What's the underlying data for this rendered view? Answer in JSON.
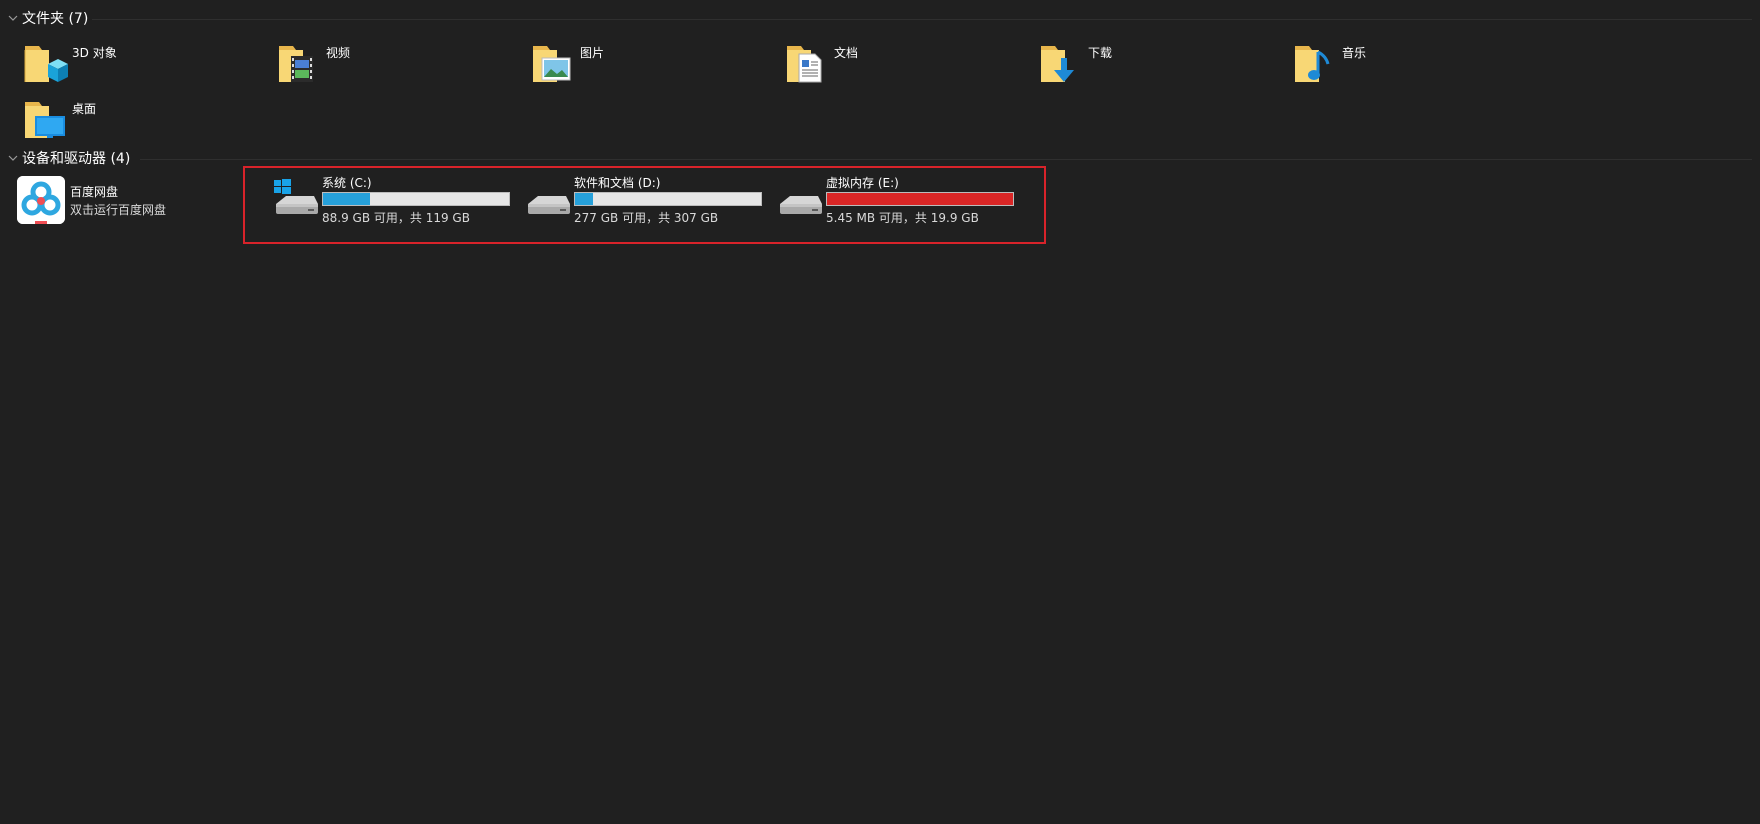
{
  "groups": {
    "folders": {
      "title": "文件夹 (7)"
    },
    "devices": {
      "title": "设备和驱动器 (4)"
    }
  },
  "folders": [
    {
      "label": "3D 对象",
      "icon": "3d-objects-folder-icon"
    },
    {
      "label": "视频",
      "icon": "videos-folder-icon"
    },
    {
      "label": "图片",
      "icon": "pictures-folder-icon"
    },
    {
      "label": "文档",
      "icon": "documents-folder-icon"
    },
    {
      "label": "下载",
      "icon": "downloads-folder-icon"
    },
    {
      "label": "音乐",
      "icon": "music-folder-icon"
    },
    {
      "label": "桌面",
      "icon": "desktop-folder-icon"
    }
  ],
  "app": {
    "name": "百度网盘",
    "subtitle": "双击运行百度网盘",
    "icon": "baidu-netdisk-icon"
  },
  "drives": [
    {
      "name": "系统 (C:)",
      "space": "88.9 GB 可用，共 119 GB",
      "used_fraction": 0.253,
      "icon": "windows-drive-icon"
    },
    {
      "name": "软件和文档 (D:)",
      "space": "277 GB 可用，共 307 GB",
      "used_fraction": 0.098,
      "icon": "hard-drive-icon"
    },
    {
      "name": "虚拟内存 (E:)",
      "space": "5.45 MB 可用，共 19.9 GB",
      "used_fraction": 0.9997,
      "icon": "hard-drive-icon"
    }
  ],
  "colors": {
    "background": "#202020",
    "bar_normal": "#26a0da",
    "bar_full": "#da2626",
    "highlight_border": "#d8232a",
    "folder_yellow": "#f8d775"
  }
}
